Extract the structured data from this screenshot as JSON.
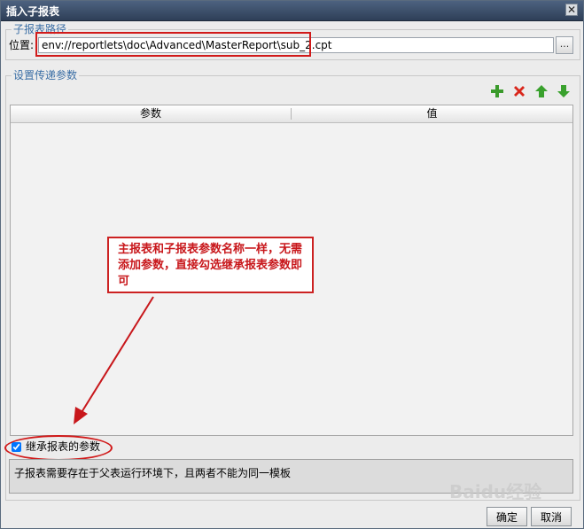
{
  "window": {
    "title": "插入子报表",
    "close_symbol": "✕"
  },
  "path_group": {
    "legend": "子报表路径",
    "label": "位置:",
    "value": "env://reportlets\\doc\\Advanced\\MasterReport\\sub_2.cpt",
    "browse_label": "..."
  },
  "params_group": {
    "legend": "设置传递参数",
    "toolbar": [
      {
        "name": "add-icon",
        "color": "#3a9a2b"
      },
      {
        "name": "delete-icon",
        "color": "#d9271c"
      },
      {
        "name": "move-up-icon",
        "color": "#39a12d"
      },
      {
        "name": "move-down-icon",
        "color": "#39a12d"
      }
    ],
    "table": {
      "columns": [
        "参数",
        "值"
      ],
      "rows": []
    }
  },
  "inherit": {
    "label": "继承报表的参数",
    "checked": true
  },
  "note": "子报表需要存在于父表运行环境下，且两者不能为同一模板",
  "buttons": {
    "ok": "确定",
    "cancel": "取消"
  },
  "callout": {
    "text": "主报表和子报表参数名称一样，无需添加参数，直接勾选继承报表参数即可",
    "color": "#c8171b"
  },
  "watermark": "Baidu经验"
}
